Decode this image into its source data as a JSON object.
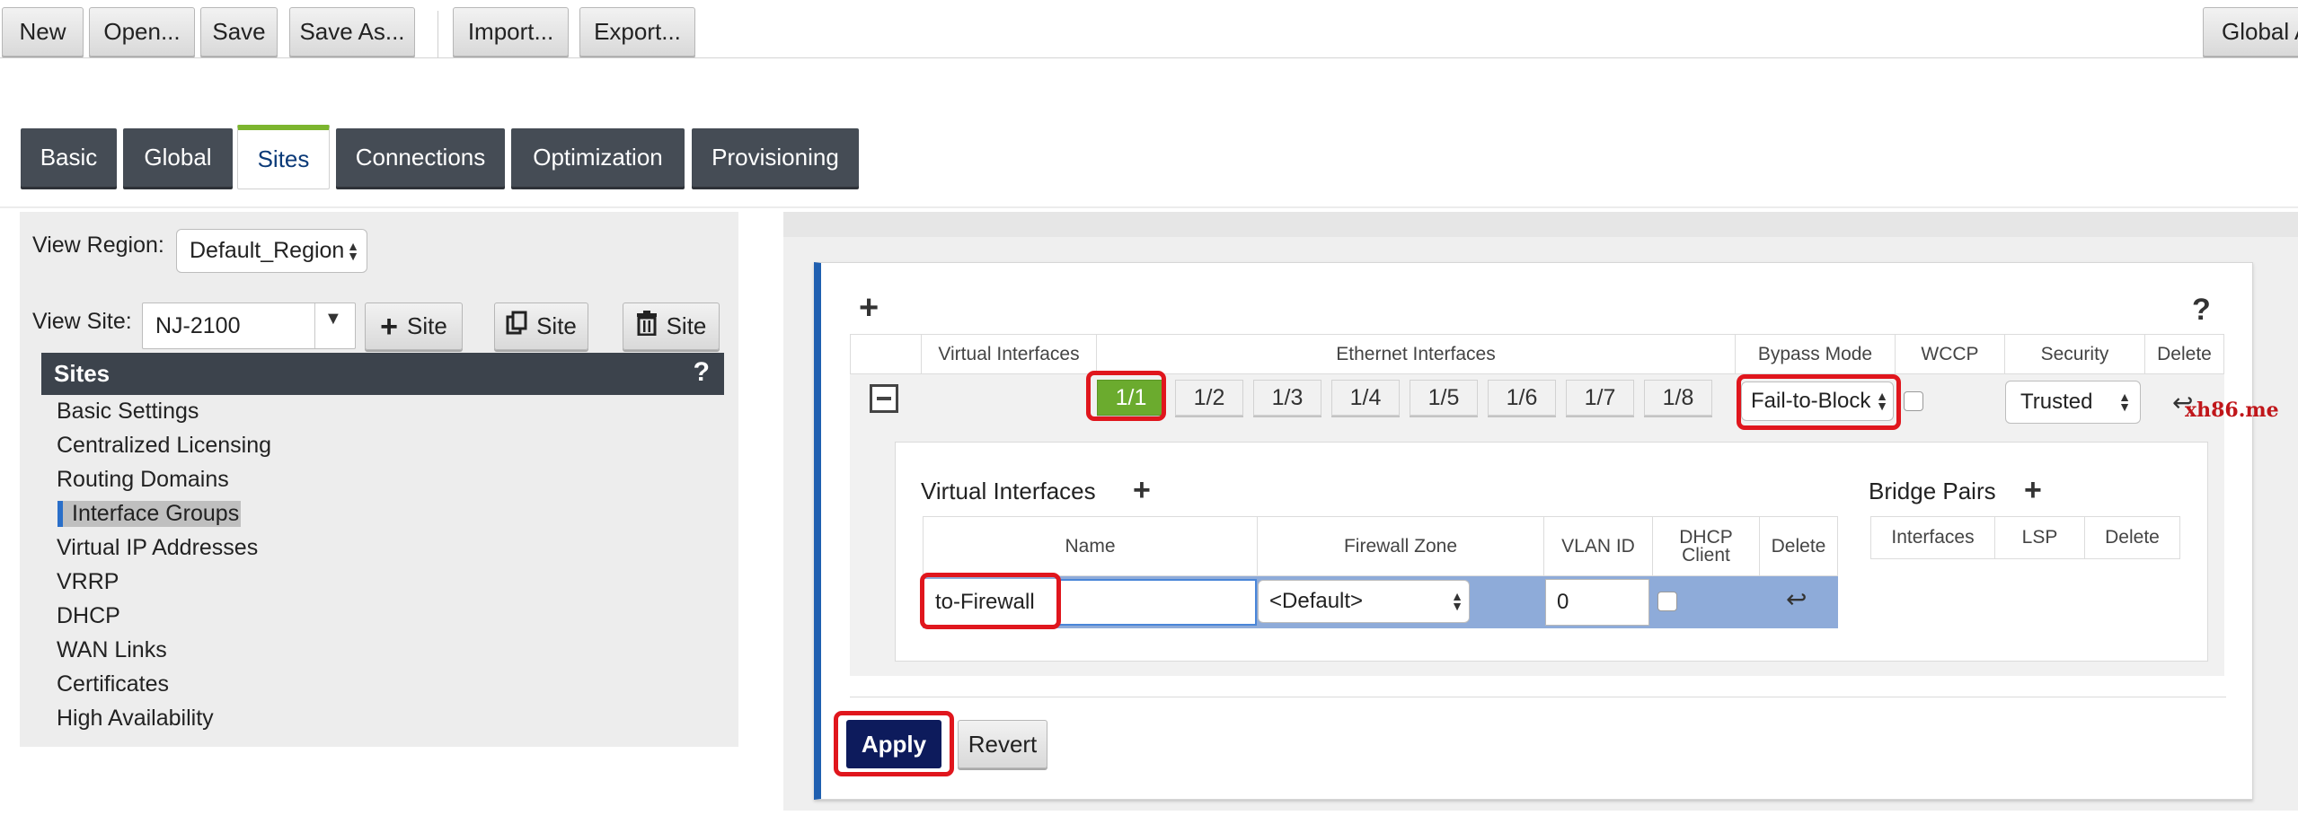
{
  "toolbar": {
    "new": "New",
    "open": "Open...",
    "save": "Save",
    "save_as": "Save As...",
    "import": "Import...",
    "export": "Export...",
    "global": "Global A"
  },
  "tabs": {
    "basic": "Basic",
    "global": "Global",
    "sites": "Sites",
    "connections": "Connections",
    "optimization": "Optimization",
    "provisioning": "Provisioning"
  },
  "left": {
    "view_region_label": "View Region:",
    "view_region_value": "Default_Region",
    "view_site_label": "View Site:",
    "view_site_value": "NJ-2100",
    "add_site": "Site",
    "clone_site": "Site",
    "delete_site": "Site",
    "sites_header": "Sites",
    "help": "?",
    "nav": [
      "Basic Settings",
      "Centralized Licensing",
      "Routing Domains",
      "Interface Groups",
      "Virtual IP Addresses",
      "VRRP",
      "DHCP",
      "WAN Links",
      "Certificates",
      "High Availability"
    ]
  },
  "interface_groups": {
    "help": "?",
    "headers": {
      "virtual_interfaces": "Virtual Interfaces",
      "ethernet_interfaces": "Ethernet Interfaces",
      "bypass_mode": "Bypass Mode",
      "wccp": "WCCP",
      "security": "Security",
      "delete": "Delete"
    },
    "ethernet_ports": [
      "1/1",
      "1/2",
      "1/3",
      "1/4",
      "1/5",
      "1/6",
      "1/7",
      "1/8"
    ],
    "selected_port": "1/1",
    "bypass_mode_value": "Fail-to-Block",
    "wccp_checked": false,
    "security_value": "Trusted",
    "watermark": "xh86.me",
    "virtual_interfaces": {
      "title": "Virtual Interfaces",
      "headers": {
        "name": "Name",
        "firewall_zone": "Firewall Zone",
        "vlan_id": "VLAN ID",
        "dhcp_client_line1": "DHCP",
        "dhcp_client_line2": "Client",
        "delete": "Delete"
      },
      "row": {
        "name_label": "to-Firewall",
        "name_value": "",
        "firewall_zone": "<Default>",
        "vlan_id": "0",
        "dhcp_client": false
      }
    },
    "bridge_pairs": {
      "title": "Bridge Pairs",
      "headers": {
        "interfaces": "Interfaces",
        "lsp": "LSP",
        "delete": "Delete"
      }
    }
  },
  "actions": {
    "apply": "Apply",
    "revert": "Revert"
  },
  "colors": {
    "tab_bg": "#454c55",
    "active_tab_accent": "#7cb52e",
    "selected_port": "#6bab2e",
    "highlight": "#e0161d",
    "apply_bg": "#0d1b5c",
    "vi_row_bg": "#8eabd9"
  }
}
